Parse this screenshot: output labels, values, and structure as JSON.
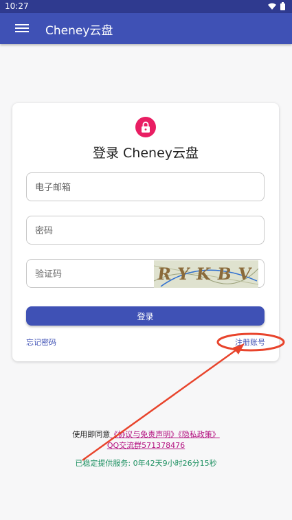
{
  "status_bar": {
    "time": "10:27"
  },
  "app_bar": {
    "title": "Cheney云盘",
    "menu_icon": "hamburger-menu-icon"
  },
  "login_card": {
    "icon": "lock-icon",
    "title": "登录 Cheney云盘",
    "email_placeholder": "电子邮箱",
    "password_placeholder": "密码",
    "captcha_placeholder": "验证码",
    "captcha_text": "RYKBV",
    "login_button": "登录",
    "forgot_password": "忘记密码",
    "register": "注册账号"
  },
  "footer": {
    "agree_prefix": "使用即同意",
    "terms_link": "《协议与免责声明》《隐私政策》",
    "qq_group": "QQ交流群571378476",
    "uptime": "已稳定提供服务: 0年42天9小时26分15秒"
  },
  "colors": {
    "primary": "#3f51b5",
    "status_bar": "#2f3a8f",
    "lock": "#e91e63",
    "link": "#b30f7f",
    "uptime": "#1a8f5f",
    "annotation": "#e8442c"
  }
}
